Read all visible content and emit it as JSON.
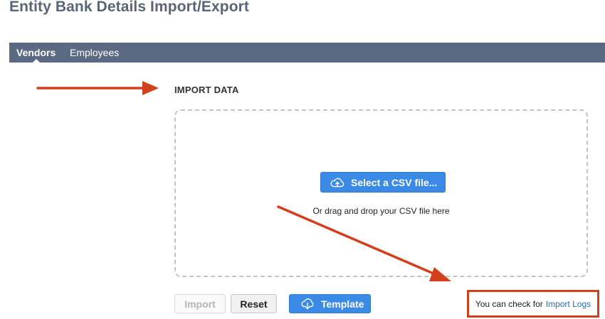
{
  "page": {
    "title": "Entity Bank Details Import/Export"
  },
  "tabs": [
    {
      "label": "Vendors",
      "active": true
    },
    {
      "label": "Employees",
      "active": false
    }
  ],
  "import_section": {
    "heading": "IMPORT DATA",
    "dropzone": {
      "select_button_label": "Select a CSV file...",
      "select_button_icon": "cloud-upload-icon",
      "hint": "Or drag and drop your CSV file here"
    }
  },
  "actions": {
    "import_label": "Import",
    "import_enabled": false,
    "reset_label": "Reset",
    "template_label": "Template",
    "template_icon": "cloud-download-icon"
  },
  "logs_note": {
    "prefix": "You can check for",
    "link_label": "Import Logs"
  },
  "colors": {
    "tab_bar": "#5b6a82",
    "title": "#5a6577",
    "primary_button": "#3b8be6",
    "annotation_red": "#d23f1c",
    "link": "#2b6cb0"
  }
}
